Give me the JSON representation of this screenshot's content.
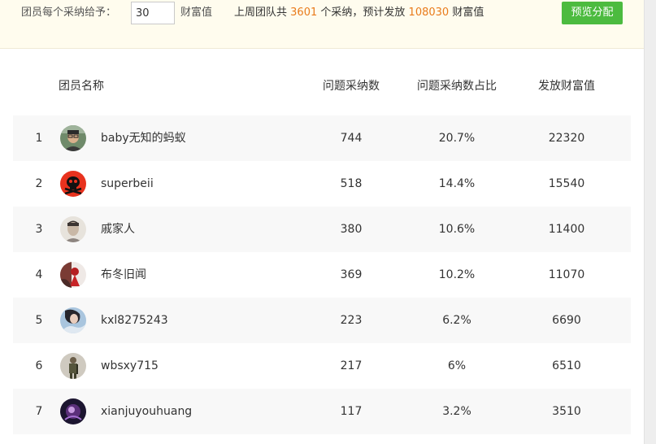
{
  "toolbar": {
    "give_label": "团员每个采纳给予：",
    "give_value": "30",
    "give_unit": "财富值",
    "summary_prefix": "上周团队共",
    "adopt_total": "3601",
    "summary_mid": "个采纳，预计发放",
    "wealth_total": "108030",
    "summary_unit": "财富值",
    "preview_label": "预览分配",
    "accent_color": "#e97b1b",
    "button_color": "#4cbb3f"
  },
  "table": {
    "headers": {
      "name": "团员名称",
      "count": "问题采纳数",
      "ratio": "问题采纳数占比",
      "wealth": "发放财富值"
    },
    "rows": [
      {
        "rank": "1",
        "name": "baby无知的蚂蚁",
        "count": "744",
        "ratio": "20.7%",
        "wealth": "22320",
        "avatar_icon": "man-glasses-avatar-icon"
      },
      {
        "rank": "2",
        "name": "superbeii",
        "count": "518",
        "ratio": "14.4%",
        "wealth": "15540",
        "avatar_icon": "skull-avatar-icon"
      },
      {
        "rank": "3",
        "name": "戚家人",
        "count": "380",
        "ratio": "10.6%",
        "wealth": "11400",
        "avatar_icon": "portrait-avatar-icon"
      },
      {
        "rank": "4",
        "name": "布冬旧闻",
        "count": "369",
        "ratio": "10.2%",
        "wealth": "11070",
        "avatar_icon": "red-figure-avatar-icon"
      },
      {
        "rank": "5",
        "name": "kxl8275243",
        "count": "223",
        "ratio": "6.2%",
        "wealth": "6690",
        "avatar_icon": "woman-avatar-icon"
      },
      {
        "rank": "6",
        "name": "wbsxy715",
        "count": "217",
        "ratio": "6%",
        "wealth": "6510",
        "avatar_icon": "soldier-avatar-icon"
      },
      {
        "rank": "7",
        "name": "xianjuyouhuang",
        "count": "117",
        "ratio": "3.2%",
        "wealth": "3510",
        "avatar_icon": "purple-avatar-icon"
      }
    ]
  }
}
